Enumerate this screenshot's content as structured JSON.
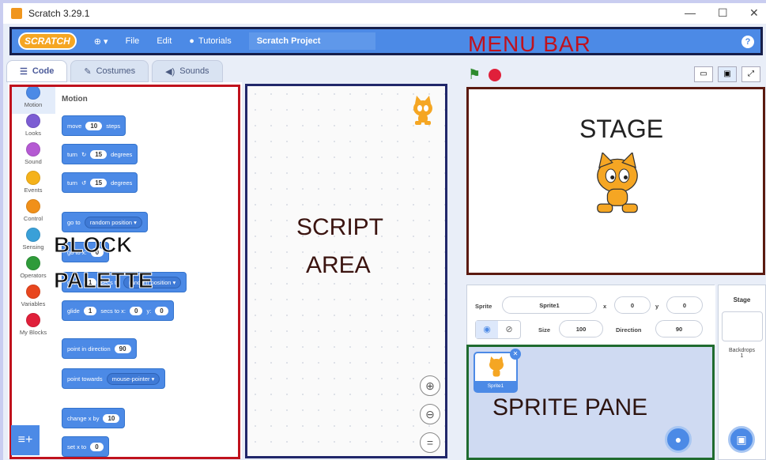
{
  "window": {
    "title": "Scratch 3.29.1",
    "controls": [
      "—",
      "☐",
      "✕"
    ]
  },
  "menu": {
    "logo": "SCRATCH",
    "globe": "⊕ ▾",
    "file": "File",
    "edit": "Edit",
    "tutorials": "Tutorials",
    "project_title": "Scratch Project",
    "help": "?"
  },
  "annotations": {
    "menu_bar": "MENU BAR",
    "stage": "STAGE",
    "script_area_1": "SCRIPT",
    "script_area_2": "AREA",
    "block_palette_1": "BLOCK",
    "block_palette_2": "PALETTE",
    "sprite_pane": "SPRITE PANE"
  },
  "tabs": {
    "code": "Code",
    "costumes": "Costumes",
    "sounds": "Sounds"
  },
  "categories": [
    {
      "label": "Motion",
      "color": "#4c8ae6"
    },
    {
      "label": "Looks",
      "color": "#7c5dd3"
    },
    {
      "label": "Sound",
      "color": "#b55ad3"
    },
    {
      "label": "Events",
      "color": "#f5b21a"
    },
    {
      "label": "Control",
      "color": "#f0901a"
    },
    {
      "label": "Sensing",
      "color": "#3aa0d8"
    },
    {
      "label": "Operators",
      "color": "#2f9b3a"
    },
    {
      "label": "Variables",
      "color": "#e8461e"
    },
    {
      "label": "My Blocks",
      "color": "#e0203a"
    }
  ],
  "palette": {
    "heading": "Motion",
    "move": {
      "a": "move",
      "n": "10",
      "b": "steps"
    },
    "turn_cw": {
      "a": "turn",
      "icon": "↻",
      "n": "15",
      "b": "degrees"
    },
    "turn_ccw": {
      "a": "turn",
      "icon": "↺",
      "n": "15",
      "b": "degrees"
    },
    "goto": {
      "a": "go to",
      "dd": "random position ▾"
    },
    "goto_xy": {
      "a": "go to x:",
      "n": "0"
    },
    "glide_to": {
      "a": "glide",
      "n": "1",
      "b": "secs to",
      "dd": "random position ▾"
    },
    "glide_xy": {
      "a": "glide",
      "n1": "1",
      "b": "secs to x:",
      "n2": "0",
      "c": "y:",
      "n3": "0"
    },
    "point_dir": {
      "a": "point in direction",
      "n": "90"
    },
    "point_towards": {
      "a": "point towards",
      "dd": "mouse-pointer ▾"
    },
    "change_x": {
      "a": "change x by",
      "n": "10"
    },
    "set_x": {
      "a": "set x to",
      "n": "0"
    }
  },
  "zoom": {
    "in": "⊕",
    "out": "⊖",
    "reset": "="
  },
  "sprite_info": {
    "sprite_label": "Sprite",
    "sprite_name": "Sprite1",
    "x_label": "x",
    "x": "0",
    "y_label": "y",
    "y": "0",
    "size_label": "Size",
    "size": "100",
    "direction_label": "Direction",
    "direction": "90"
  },
  "sprite_tile": {
    "name": "Sprite1"
  },
  "stage_panel": {
    "title": "Stage",
    "backdrops_label": "Backdrops",
    "backdrops_count": "1"
  },
  "colors": {
    "menubar": "#4c8ae6",
    "accent": "#4c8ae6",
    "palette_border": "#c0121d",
    "script_border": "#21276a",
    "stage_border": "#5b1a10",
    "sprite_border": "#1f6b2f"
  }
}
